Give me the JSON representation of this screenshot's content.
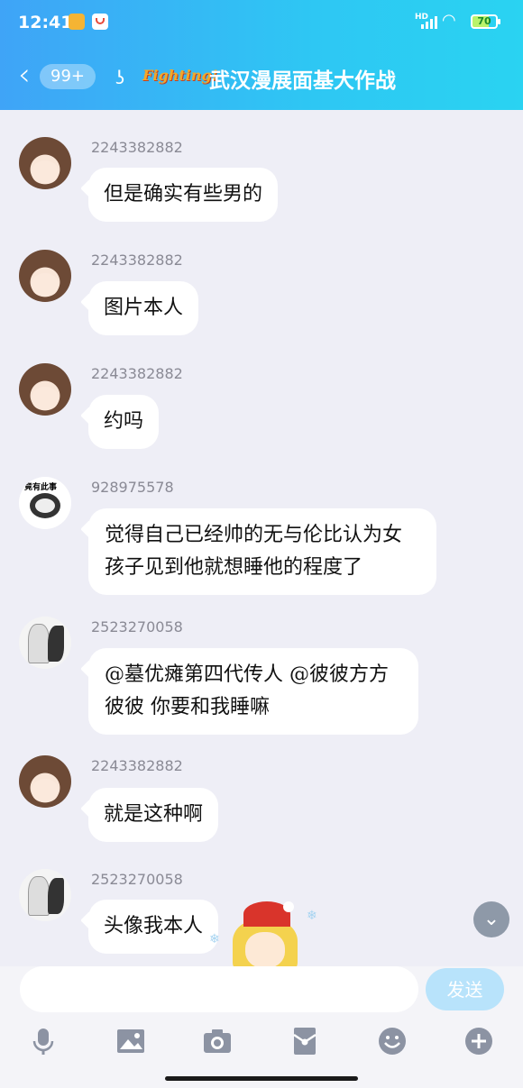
{
  "status_bar": {
    "time": "12:41",
    "network": "HD",
    "battery": "70"
  },
  "header": {
    "back_icon": "chevron-left-icon",
    "unread_badge": "99+",
    "ear_icon": "ear-icon",
    "logo_text": "Fighting!",
    "title": "武汉漫展面基大作战"
  },
  "messages": [
    {
      "user": "2243382882",
      "text": "但是确实有些男的",
      "avatar": "anime-girl-avatar"
    },
    {
      "user": "2243382882",
      "text": "图片本人",
      "avatar": "anime-girl-avatar"
    },
    {
      "user": "2243382882",
      "text": "约吗",
      "avatar": "anime-girl-avatar"
    },
    {
      "user": "928975578",
      "text": "觉得自己已经帅的无与伦比认为女孩子见到他就想睡他的程度了",
      "avatar": "panda-meme-avatar",
      "avatar_text": "竟有此事"
    },
    {
      "user": "2523270058",
      "text": "@墓优瘫第四代传人 @彼彼方方彼彼 你要和我睡嘛",
      "avatar": "sketch-avatar"
    },
    {
      "user": "2243382882",
      "text": "就是这种啊",
      "avatar": "anime-girl-avatar"
    },
    {
      "user": "2523270058",
      "text": "头像我本人",
      "avatar": "sketch-avatar"
    }
  ],
  "composer": {
    "placeholder": "",
    "send_label": "发送"
  },
  "toolbar": [
    "microphone-icon",
    "image-icon",
    "camera-icon",
    "red-packet-icon",
    "emoji-icon",
    "plus-icon"
  ],
  "colors": {
    "header_start": "#3fa4f7",
    "header_end": "#2ad3f2",
    "send_disabled": "#b8e3fb",
    "background": "#eeeef6"
  }
}
